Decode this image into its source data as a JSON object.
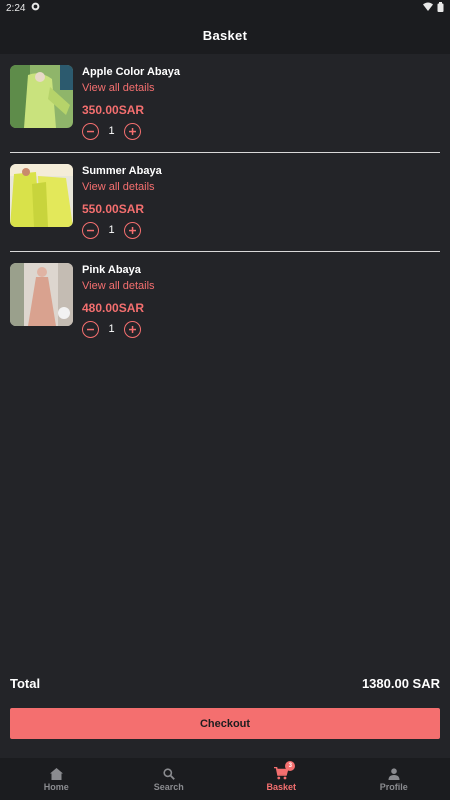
{
  "status_bar": {
    "time": "2:24"
  },
  "header": {
    "title": "Basket"
  },
  "items": [
    {
      "name": "Apple Color Abaya",
      "details_link": "View all details",
      "price": "350.00SAR",
      "quantity": "1"
    },
    {
      "name": "Summer Abaya",
      "details_link": "View all details",
      "price": "550.00SAR",
      "quantity": "1"
    },
    {
      "name": "Pink Abaya",
      "details_link": "View all details",
      "price": "480.00SAR",
      "quantity": "1"
    }
  ],
  "summary": {
    "total_label": "Total",
    "total_value": "1380.00 SAR"
  },
  "checkout_label": "Checkout",
  "nav": [
    {
      "label": "Home",
      "icon": "home-icon"
    },
    {
      "label": "Search",
      "icon": "search-icon"
    },
    {
      "label": "Basket",
      "icon": "cart-icon",
      "badge": "3",
      "active": true
    },
    {
      "label": "Profile",
      "icon": "person-icon"
    }
  ],
  "colors": {
    "accent": "#f46f6f",
    "background": "#232428",
    "bar": "#1b1c1f"
  }
}
